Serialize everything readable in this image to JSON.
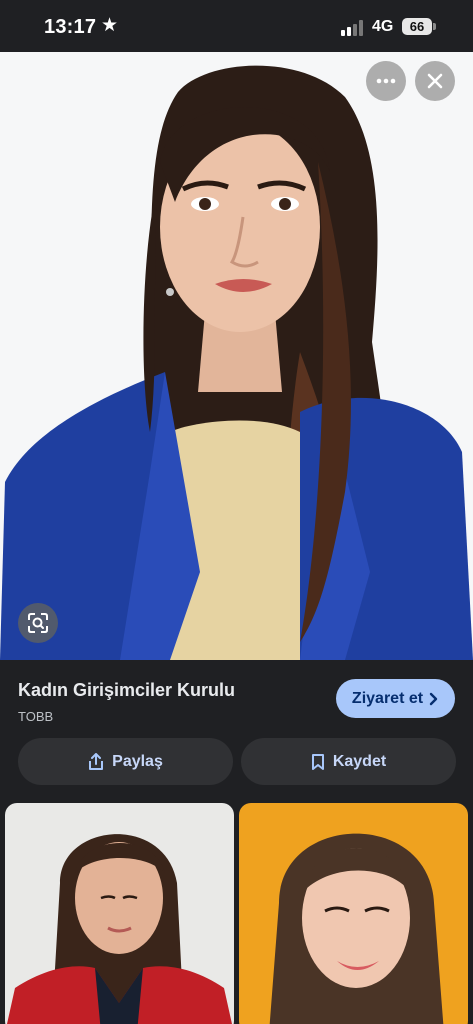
{
  "status_bar": {
    "time": "13:17",
    "network": "4G",
    "battery": "66"
  },
  "result": {
    "title": "Kadın Girişimciler Kurulu",
    "source": "TOBB",
    "visit_label": "Ziyaret et"
  },
  "actions": {
    "share_label": "Paylaş",
    "save_label": "Kaydet"
  },
  "icons": [
    "star-icon",
    "signal-icon",
    "battery-icon",
    "more-icon",
    "close-icon",
    "lens-icon",
    "share-icon",
    "bookmark-icon",
    "chevron-right-icon"
  ],
  "colors": {
    "background": "#1f2023",
    "accent_button": "#a8c7fa",
    "accent_text": "#062e6f",
    "secondary_button": "#303134"
  }
}
